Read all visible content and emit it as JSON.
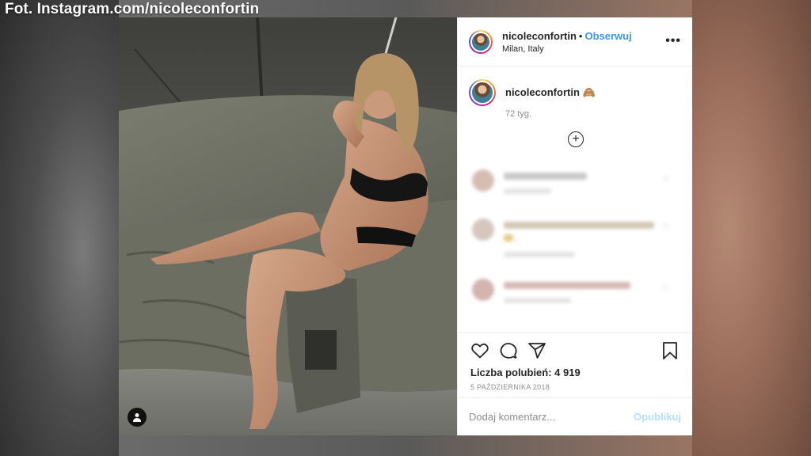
{
  "credit": "Fot. Instagram.com/nicoleconfortin",
  "post": {
    "username": "nicoleconfortin",
    "separator": "•",
    "follow_label": "Obserwuj",
    "location": "Milan, Italy",
    "more_label": "•••",
    "caption": {
      "username": "nicoleconfortin",
      "emoji": "🙈",
      "time_ago": "72 tyg."
    },
    "load_more_label": "+",
    "likes_text": "Liczba polubień: 4 919",
    "date": "5 PAŹDZIERNIKA 2018",
    "comment_placeholder": "Dodaj komentarz...",
    "publish_label": "Opublikuj"
  },
  "icons": {
    "more": "more-options-icon",
    "load_more": "plus-circle-icon",
    "like": "heart-icon",
    "comment": "comment-icon",
    "share": "send-icon",
    "save": "bookmark-icon",
    "user_tag": "user-tag-icon"
  },
  "colors": {
    "follow": "#3897f0",
    "publish": "#b2dffc",
    "text": "#262626",
    "muted": "#8e8e8e"
  }
}
